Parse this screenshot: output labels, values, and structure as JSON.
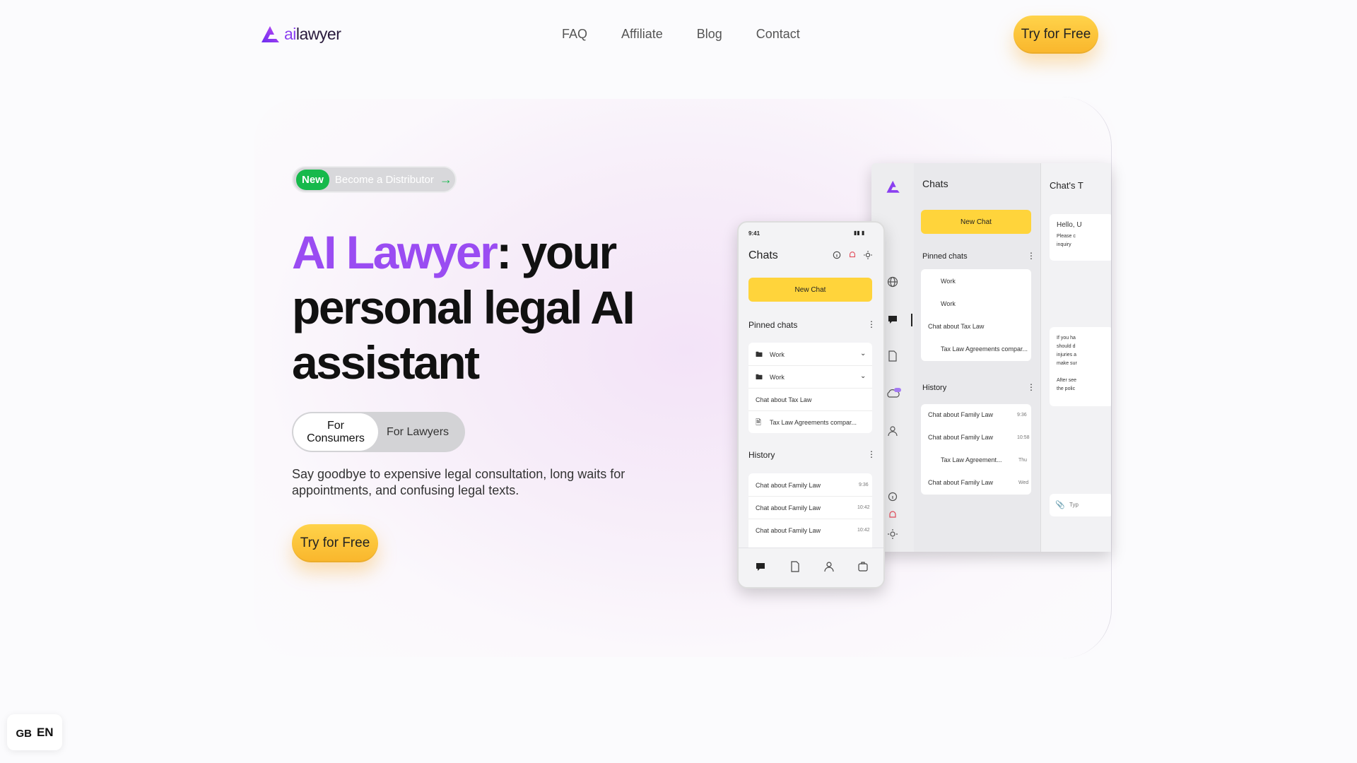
{
  "nav": {
    "logo_ai": "ai",
    "logo_rest": "lawyer",
    "links": [
      "FAQ",
      "Affiliate",
      "Blog",
      "Contact"
    ],
    "cta": "Try for Free"
  },
  "hero": {
    "badge_new": "New",
    "badge_text": "Become a Distributor",
    "headline_accent": "AI Lawyer",
    "headline_rest": ": your personal legal AI assistant",
    "toggle": [
      "For Consumers",
      "For Lawyers"
    ],
    "subtitle": "Say goodbye to expensive legal consultation, long waits for appointments, and confusing legal texts.",
    "cta": "Try for Free"
  },
  "phone_mock": {
    "time": "9:41",
    "title": "Chats",
    "new_chat": "New Chat",
    "pinned_title": "Pinned chats",
    "pinned": [
      "Work",
      "Work",
      "Chat about Tax Law",
      "Tax Law Agreements compar..."
    ],
    "history_title": "History",
    "history": [
      {
        "label": "Chat about Family Law",
        "time": "9:36"
      },
      {
        "label": "Chat about Family Law",
        "time": "10:42"
      },
      {
        "label": "Chat about Family Law",
        "time": "10:42"
      }
    ]
  },
  "desktop_mock": {
    "title": "Chats",
    "new_chat": "New Chat",
    "pinned_title": "Pinned chats",
    "pinned": [
      "Work",
      "Work",
      "Chat about Tax Law",
      "Tax Law Agreements compar..."
    ],
    "history_title": "History",
    "history": [
      {
        "label": "Chat about Family Law",
        "time": "9:36"
      },
      {
        "label": "Chat about Family Law",
        "time": "10:58"
      },
      {
        "label": "Tax Law Agreement...",
        "time": "Thu"
      },
      {
        "label": "Chat about Family Law",
        "time": "Wed"
      }
    ],
    "right_title": "Chat's T",
    "right_greeting": "Hello, U",
    "right_sub1": "Please c",
    "right_sub2": "inquiry",
    "right_p1": [
      "If you ha",
      "should d",
      "injuries a",
      "make sur"
    ],
    "right_p2": [
      "After see",
      "the polic"
    ],
    "input_placeholder": "Typ"
  },
  "language": {
    "flag": "GB",
    "code": "EN"
  },
  "colors": {
    "accent_purple": "#9a4cf2",
    "cta_yellow": "#ffc93a",
    "badge_green": "#16b94b"
  }
}
